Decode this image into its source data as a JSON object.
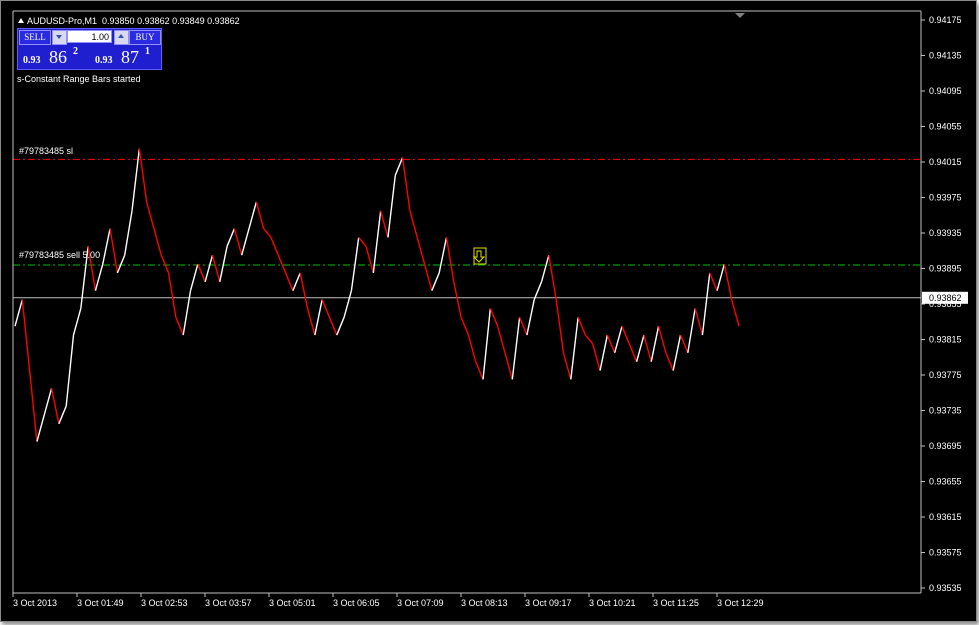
{
  "header": {
    "symbol": "AUDUSD-Pro,M1",
    "ohlc": "0.93850 0.93862 0.93849 0.93862"
  },
  "trade_panel": {
    "sell_label": "SELL",
    "buy_label": "BUY",
    "lot_value": "1.00",
    "sell_quote": {
      "prefix": "0.93",
      "big": "86",
      "sup": "2"
    },
    "buy_quote": {
      "prefix": "0.93",
      "big": "87",
      "sup": "1"
    }
  },
  "status_message": "s-Constant Range Bars started",
  "lines": {
    "sl_label": "#79783485 sl",
    "sell_label": "#79783485 sell 5.00",
    "current_price_label": "0.93862"
  },
  "colors": {
    "background": "#000000",
    "grid_axis": "#c0c0c0",
    "bull": "#ffffff",
    "bear": "#ff0000",
    "sl_line": "#ff0000",
    "entry_line": "#00c000",
    "price_line": "#c0c0c0",
    "panel": "#1f1fcf",
    "arrow_marker": "#e0e000"
  },
  "chart_data": {
    "type": "line",
    "title": "AUDUSD-Pro,M1",
    "y_ticks": [
      "0.94175",
      "0.94135",
      "0.94095",
      "0.94055",
      "0.94015",
      "0.93975",
      "0.93935",
      "0.93895",
      "0.93855",
      "0.93815",
      "0.93775",
      "0.93735",
      "0.93695",
      "0.93655",
      "0.93615",
      "0.93575",
      "0.93535"
    ],
    "x_ticks": [
      "3 Oct 2013",
      "3 Oct 01:49",
      "3 Oct 02:53",
      "3 Oct 03:57",
      "3 Oct 05:01",
      "3 Oct 06:05",
      "3 Oct 07:09",
      "3 Oct 08:13",
      "3 Oct 09:17",
      "3 Oct 10:21",
      "3 Oct 11:25",
      "3 Oct 12:29"
    ],
    "ylim": [
      0.93525,
      0.94185
    ],
    "levels": {
      "stop_loss": 0.94018,
      "sell_entry": 0.93899,
      "current_price": 0.93862
    },
    "series": [
      {
        "values": [
          0.9383,
          0.9386,
          0.9378,
          0.937,
          0.9373,
          0.9376,
          0.9372,
          0.9374,
          0.9382,
          0.9385,
          0.9392,
          0.9387,
          0.939,
          0.9394,
          0.9389,
          0.9391,
          0.9396,
          0.9403,
          0.9397,
          0.9394,
          0.9391,
          0.9389,
          0.9384,
          0.9382,
          0.9387,
          0.939,
          0.9388,
          0.9391,
          0.9388,
          0.9392,
          0.9394,
          0.9391,
          0.9394,
          0.9397,
          0.9394,
          0.9393,
          0.9391,
          0.9389,
          0.9387,
          0.9389,
          0.9385,
          0.9382,
          0.9386,
          0.9384,
          0.9382,
          0.9384,
          0.9387,
          0.9393,
          0.9392,
          0.9389,
          0.9396,
          0.9393,
          0.94,
          0.9402,
          0.9396,
          0.9393,
          0.939,
          0.9387,
          0.9389,
          0.9393,
          0.9388,
          0.9384,
          0.9382,
          0.9379,
          0.9377,
          0.9385,
          0.9383,
          0.938,
          0.9377,
          0.9384,
          0.9382,
          0.9386,
          0.9388,
          0.9391,
          0.9386,
          0.938,
          0.9377,
          0.9384,
          0.9382,
          0.9381,
          0.9378,
          0.9382,
          0.938,
          0.9383,
          0.9381,
          0.9379,
          0.9382,
          0.9379,
          0.9383,
          0.938,
          0.9378,
          0.9382,
          0.938,
          0.9385,
          0.9382,
          0.9389,
          0.9387,
          0.939,
          0.9386,
          0.9383
        ]
      }
    ]
  }
}
